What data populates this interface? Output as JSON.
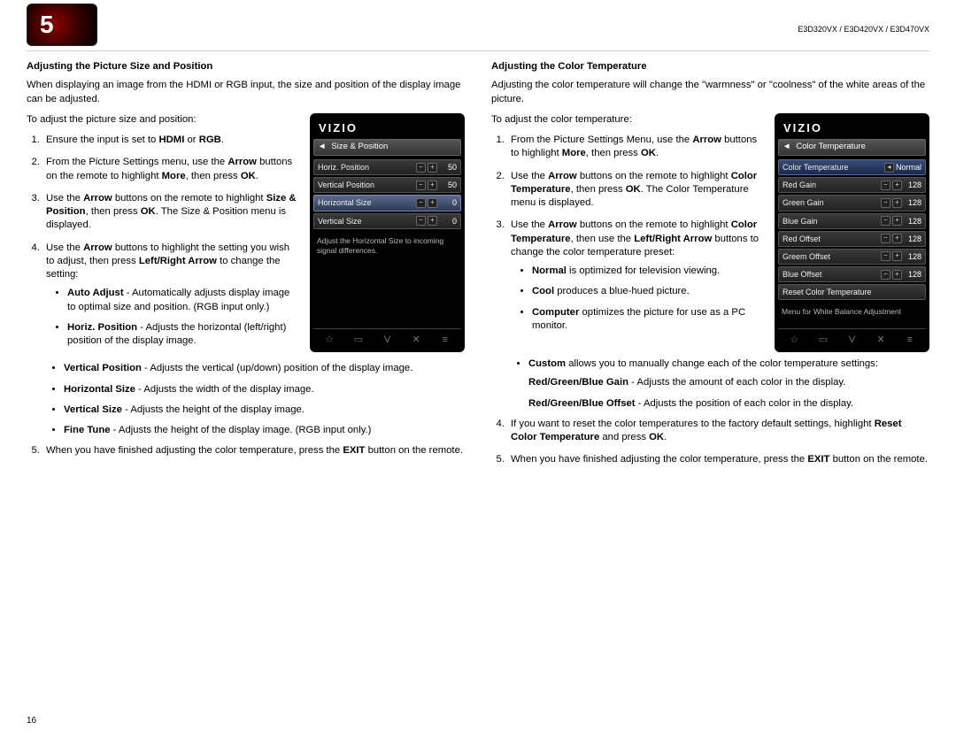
{
  "header": {
    "chapter": "5",
    "models": "E3D320VX / E3D420VX / E3D470VX"
  },
  "pageNumber": "16",
  "left": {
    "title": "Adjusting the Picture Size and Position",
    "intro": "When displaying an image from the HDMI or RGB input, the size and position of the display image can be adjusted.",
    "lead": "To adjust the picture size and position:",
    "s1a": "Ensure the input is set to ",
    "s1b": "HDMI",
    "s1c": " or ",
    "s1d": "RGB",
    "s1e": ".",
    "s2a": "From the Picture Settings menu, use the ",
    "s2b": "Arrow",
    "s2c": " buttons on the remote to highlight ",
    "s2d": "More",
    "s2e": ", then press ",
    "s2f": "OK",
    "s2g": ".",
    "s3a": "Use the ",
    "s3b": "Arrow",
    "s3c": " buttons on the remote to highlight ",
    "s3d": "Size & Position",
    "s3e": ", then press ",
    "s3f": "OK",
    "s3g": ". The Size & Position menu is displayed.",
    "s4a": "Use the ",
    "s4b": "Arrow",
    "s4c": " buttons to highlight the setting you wish to adjust, then press ",
    "s4d": "Left/Right Arrow",
    "s4e": " to change the setting:",
    "b1a": "Auto Adjust",
    "b1b": " - Automatically adjusts display image to optimal size and position. (RGB input only.)",
    "b2a": "Horiz. Position",
    "b2b": " - Adjusts the horizontal (left/right) position of the display image.",
    "b3a": "Vertical Position",
    "b3b": " - Adjusts the vertical (up/down) position of the display image.",
    "b4a": "Horizontal Size",
    "b4b": " - Adjusts the width of the display image.",
    "b5a": "Vertical Size",
    "b5b": " - Adjusts the height of the display image.",
    "b6a": "Fine Tune",
    "b6b": " - Adjusts the height of the display image. (RGB input only.)",
    "s5a": "When you have finished adjusting the color temperature, press the ",
    "s5b": "EXIT",
    "s5c": " button on the remote.",
    "fig": {
      "brand": "VIZIO",
      "title": "Size & Position",
      "rows": [
        {
          "label": "Horiz. Position",
          "value": "50"
        },
        {
          "label": "Vertical Position",
          "value": "50"
        },
        {
          "label": "Horizontal Size",
          "value": "0",
          "sel": true
        },
        {
          "label": "Vertical Size",
          "value": "0"
        }
      ],
      "desc": "Adjust the Horizontal Size to incoming signal differences."
    }
  },
  "right": {
    "title": "Adjusting the Color Temperature",
    "intro": "Adjusting the color temperature will change the \"warmness\" or \"coolness\" of the white areas of the picture.",
    "lead": "To adjust the color temperature:",
    "s1a": "From the Picture Settings Menu, use the ",
    "s1b": "Arrow",
    "s1c": " buttons to highlight ",
    "s1d": "More",
    "s1e": ", then press ",
    "s1f": "OK",
    "s1g": ".",
    "s2a": "Use the ",
    "s2b": "Arrow",
    "s2c": " buttons on the remote to highlight ",
    "s2d": "Color Temperature",
    "s2e": ", then press ",
    "s2f": "OK",
    "s2g": ". The Color Temperature menu is displayed.",
    "s3a": "Use the ",
    "s3b": "Arrow",
    "s3c": " buttons on the remote to highlight ",
    "s3d": "Color Temperature",
    "s3e": ", then use the ",
    "s3f": "Left/Right Arrow",
    "s3g": " buttons to change the color temperature preset:",
    "b1a": "Normal",
    "b1b": " is optimized for television viewing.",
    "b2a": "Cool",
    "b2b": " produces a blue-hued picture.",
    "b3a": "Computer",
    "b3b": " optimizes the picture for use as a PC monitor.",
    "b4a": "Custom",
    "b4b": " allows you to manually change each of the color temperature settings:",
    "sub1a": "Red/Green/Blue Gain",
    "sub1b": " - Adjusts the amount of each color in the display.",
    "sub2a": "Red/Green/Blue Offset",
    "sub2b": " - Adjusts the position of each color in the display.",
    "s4a": "If you want to reset the color temperatures to the factory default settings, highlight ",
    "s4b": "Reset Color Temperature",
    "s4c": " and press ",
    "s4d": "OK",
    "s4e": ".",
    "s5a": "When you have finished adjusting the color temperature, press the ",
    "s5b": "EXIT",
    "s5c": " button on the remote.",
    "fig": {
      "brand": "VIZIO",
      "title": "Color Temperature",
      "head": {
        "label": "Color Temperature",
        "value": "Normal"
      },
      "rows": [
        {
          "label": "Red Gain",
          "value": "128"
        },
        {
          "label": "Green Gain",
          "value": "128"
        },
        {
          "label": "Blue Gain",
          "value": "128"
        },
        {
          "label": "Red Offset",
          "value": "128"
        },
        {
          "label": "Greem Offset",
          "value": "128"
        },
        {
          "label": "Blue Offset",
          "value": "128"
        }
      ],
      "reset": "Reset Color Temperature",
      "desc": "Menu for White Balance Adjustment"
    }
  }
}
